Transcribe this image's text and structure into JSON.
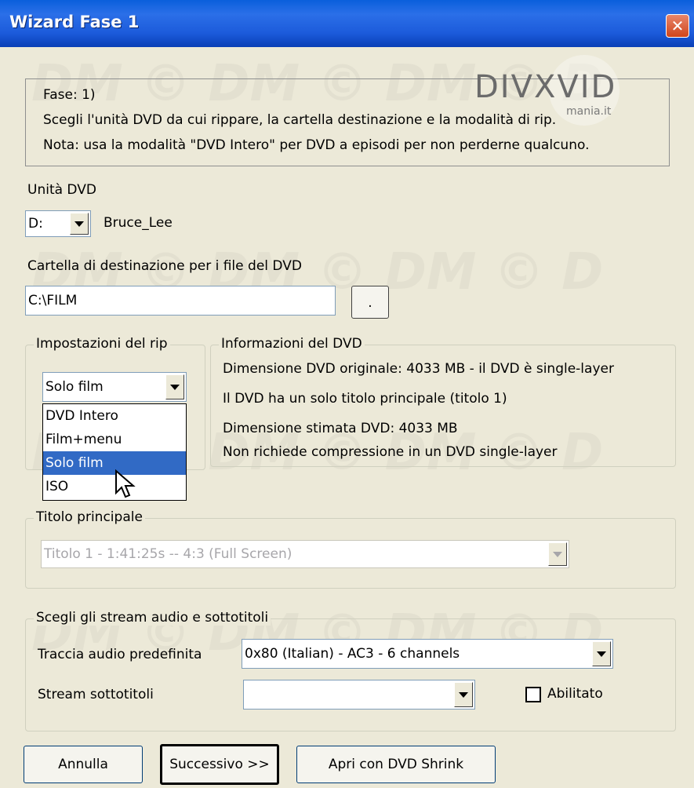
{
  "window": {
    "title": "Wizard Fase 1",
    "close_glyph": "✕"
  },
  "logo": {
    "text": "DIVXVID",
    "subtext": "mania.it",
    "watermark": "DM © DM © DM © D"
  },
  "info": {
    "line1": "Fase: 1)",
    "line2": "Scegli l'unità DVD da cui rippare, la cartella destinazione e la modalità di rip.",
    "line3": "Nota: usa la modalità \"DVD Intero\" per DVD a episodi per non perderne qualcuno."
  },
  "dvd_drive": {
    "label": "Unità DVD",
    "selected": "D:",
    "volume_name": "Bruce_Lee"
  },
  "destination": {
    "label": "Cartella di destinazione per i file del DVD",
    "value": "C:\\FILM",
    "browse_label": "."
  },
  "rip_settings": {
    "label": "Impostazioni del rip",
    "selected": "Solo film",
    "options": [
      "DVD Intero",
      "Film+menu",
      "Solo film",
      "ISO"
    ],
    "highlighted_index": 2
  },
  "dvd_info": {
    "label": "Informazioni del DVD",
    "line1": "Dimensione DVD originale: 4033 MB - il DVD è single-layer",
    "line2": "Il DVD ha un solo titolo principale (titolo 1)",
    "line3": "Dimensione stimata DVD: 4033 MB",
    "line4": "Non richiede compressione in un DVD single-layer"
  },
  "main_title": {
    "label": "Titolo principale",
    "selected": "Titolo 1 - 1:41:25s -- 4:3 (Full Screen)",
    "enabled": false
  },
  "streams": {
    "label": "Scegli gli stream audio e sottotitoli",
    "audio_label": "Traccia audio predefinita",
    "audio_selected": "0x80 (Italian) - AC3 - 6 channels",
    "subtitle_label": "Stream sottotitoli",
    "subtitle_selected": "",
    "enabled_label": "Abilitato",
    "enabled_checked": false
  },
  "buttons": {
    "cancel": "Annulla",
    "next": "Successivo >>",
    "open_shrink": "Apri con DVD Shrink"
  },
  "colors": {
    "titlebar": "#0A5FDC",
    "dialog_bg": "#ECE9D8",
    "selection": "#316AC5",
    "close_button": "#D0451B"
  }
}
